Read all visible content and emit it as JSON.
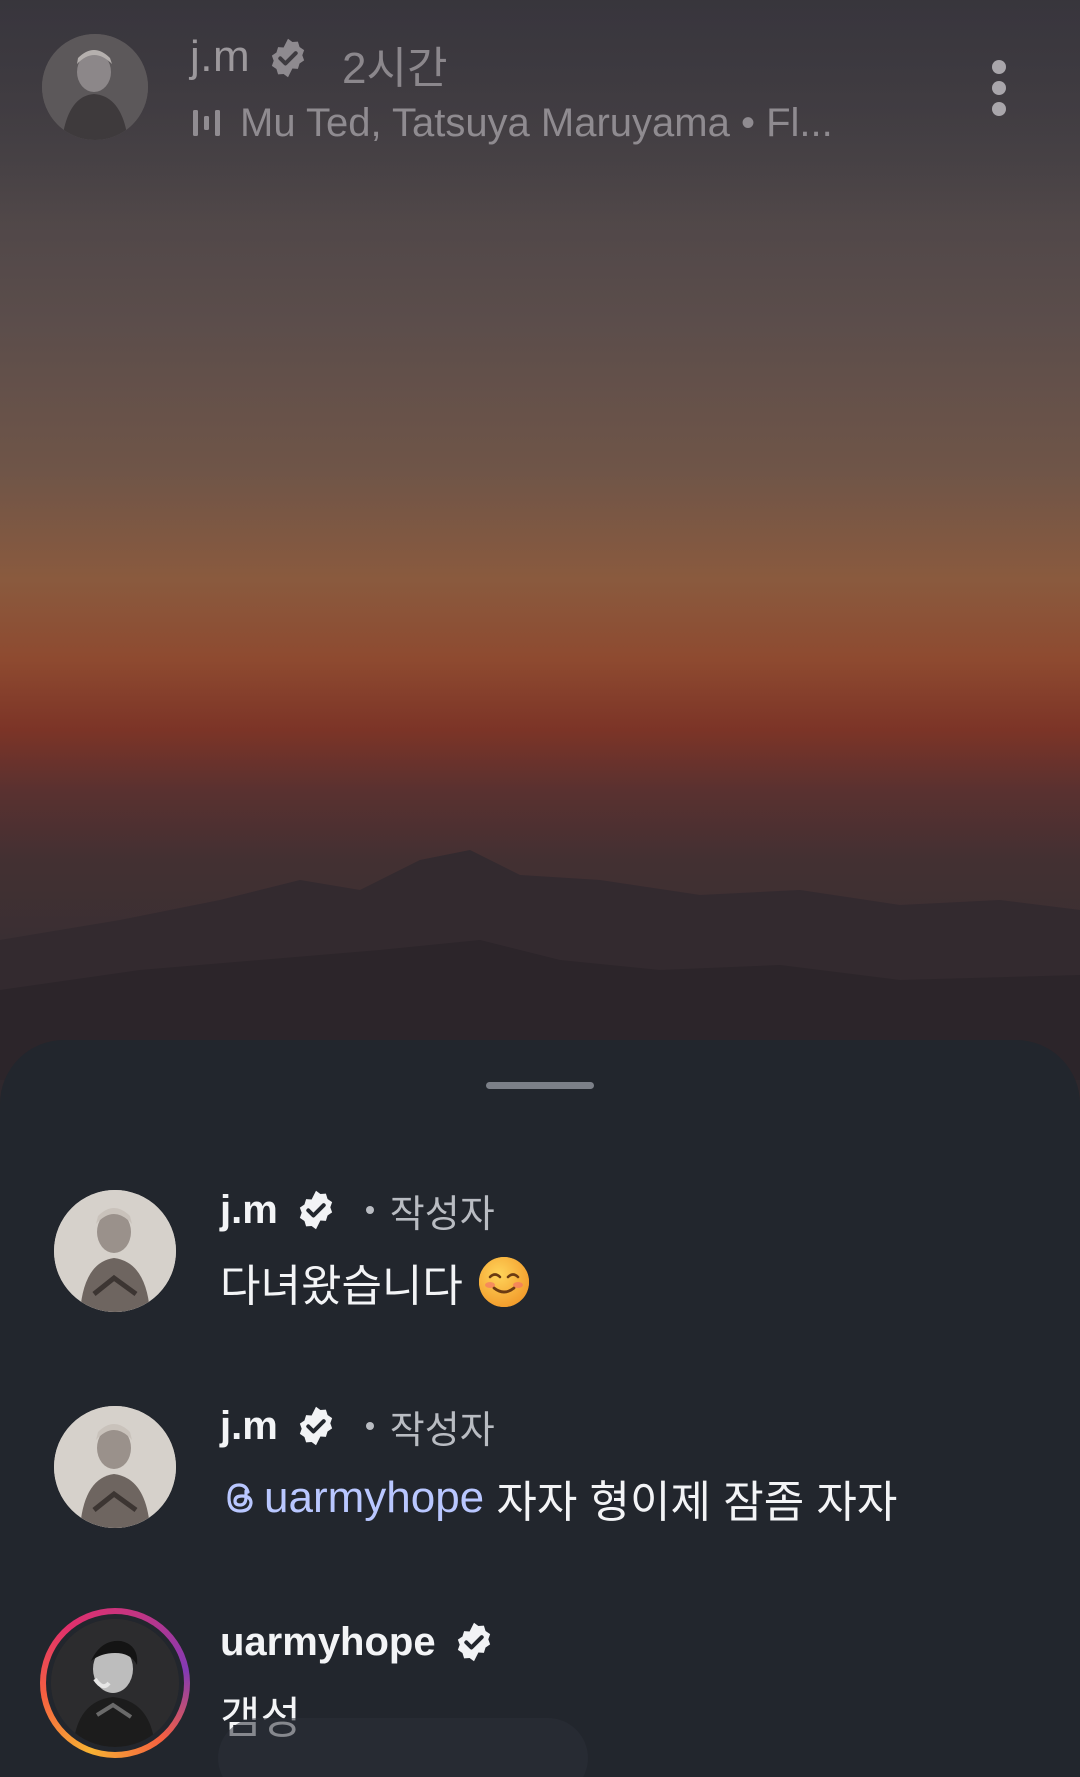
{
  "header": {
    "username": "j.m",
    "time": "2시간",
    "music": "Mu Ted, Tatsuya Maruyama • Fl...",
    "icons": {
      "verified": "verified-badge-icon",
      "music": "music-bars-icon",
      "more": "more-vertical-icon"
    }
  },
  "sheet": {
    "comments": [
      {
        "username": "j.m",
        "author_label": "작성자",
        "text": "다녀왔습니다",
        "emoji": "smiling-face-icon"
      },
      {
        "username": "j.m",
        "author_label": "작성자",
        "mention": "uarmyhope",
        "text": " 자자 형이제 잠좀 자자"
      },
      {
        "username": "uarmyhope",
        "text": "갬성"
      }
    ]
  },
  "colors": {
    "sheet_bg": "#22262d",
    "mention": "#b9c7ff",
    "text": "#f3f4f6"
  }
}
